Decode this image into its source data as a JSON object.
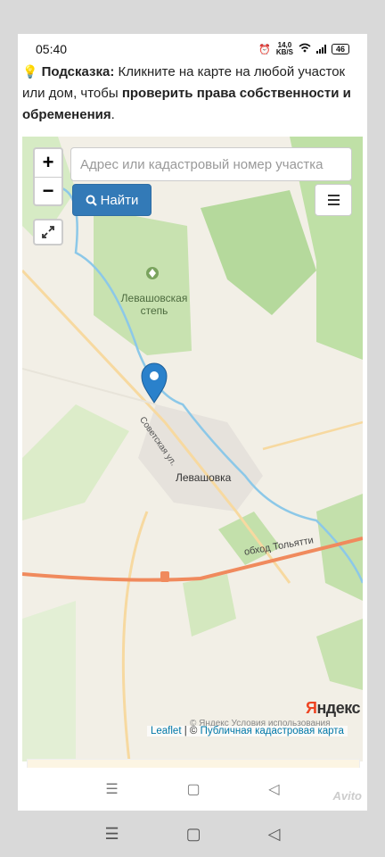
{
  "statusbar": {
    "time": "05:40",
    "net_speed": "14,0",
    "net_unit": "KB/S",
    "battery": "46"
  },
  "hint": {
    "icon": "lightbulb-icon",
    "label": "Подсказка:",
    "text_1": " Кликните на карте на любой участок или дом, чтобы ",
    "bold": "проверить права собственности и обременения",
    "text_2": "."
  },
  "map": {
    "zoom_in": "+",
    "zoom_out": "−",
    "search_placeholder": "Адрес или кадастровый номер участка",
    "find_label": "Найти",
    "labels": {
      "levashovskaya": "Левашовская степь",
      "levashovka": "Левашовка",
      "street": "Советская ул.",
      "bypass": "обход Тольятти"
    },
    "yandex_logo_red": "Я",
    "yandex_logo_rest": "ндекс",
    "terms": "© Яндекс  Условия использования",
    "attribution": {
      "leaflet": "Leaflet",
      "sep": " | © ",
      "cadastre": "Публичная кадастровая карта"
    },
    "colors": {
      "forest": "#c8e2b0",
      "river": "#8cc8e8",
      "road_main": "#f08a5d",
      "road_minor": "#f7d9a0",
      "marker": "#2a81cb"
    }
  },
  "navbar": {
    "menu": "☰",
    "home": "▢",
    "back": "◁"
  },
  "watermark": "Avito"
}
